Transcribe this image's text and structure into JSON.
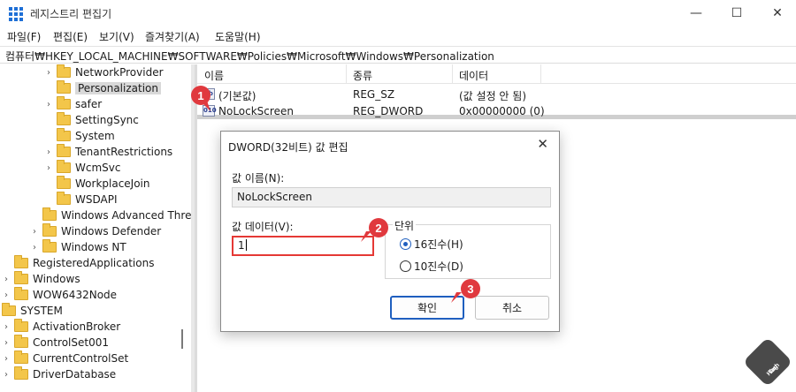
{
  "window": {
    "title": "레지스트리 편집기",
    "min_glyph": "—",
    "max_glyph": "☐",
    "close_glyph": "✕"
  },
  "menu": [
    "파일(F)",
    "편집(E)",
    "보기(V)",
    "즐겨찾기(A)",
    "도움말(H)"
  ],
  "address": "컴퓨터₩HKEY_LOCAL_MACHINE₩SOFTWARE₩Policies₩Microsoft₩Windows₩Personalization",
  "tree": [
    {
      "label": "NetworkProvider",
      "chevron": "›"
    },
    {
      "label": "Personalization",
      "chevron": "",
      "selected": true
    },
    {
      "label": "safer",
      "chevron": "›"
    },
    {
      "label": "SettingSync",
      "chevron": ""
    },
    {
      "label": "System",
      "chevron": ""
    },
    {
      "label": "TenantRestrictions",
      "chevron": "›"
    },
    {
      "label": "WcmSvc",
      "chevron": "›"
    },
    {
      "label": "WorkplaceJoin",
      "chevron": ""
    },
    {
      "label": "WSDAPI",
      "chevron": ""
    },
    {
      "label": "Windows Advanced Threat",
      "chevron": ""
    },
    {
      "label": "Windows Defender",
      "chevron": "›"
    },
    {
      "label": "Windows NT",
      "chevron": "›"
    },
    {
      "label": "RegisteredApplications",
      "chevron": ""
    },
    {
      "label": "Windows",
      "chevron": "›"
    },
    {
      "label": "WOW6432Node",
      "chevron": "›"
    },
    {
      "label": "SYSTEM",
      "chevron": ""
    },
    {
      "label": "ActivationBroker",
      "chevron": "›"
    },
    {
      "label": "ControlSet001",
      "chevron": "›"
    },
    {
      "label": "CurrentControlSet",
      "chevron": "›"
    },
    {
      "label": "DriverDatabase",
      "chevron": "›"
    }
  ],
  "list": {
    "columns": [
      "이름",
      "종류",
      "데이터"
    ],
    "rows": [
      {
        "name": "(기본값)",
        "type": "REG_SZ",
        "data": "(값 설정 안 됨)",
        "icon": "ab"
      },
      {
        "name": "NoLockScreen",
        "type": "REG_DWORD",
        "data": "0x00000000 (0)",
        "icon": "010"
      }
    ]
  },
  "dialog": {
    "title": "DWORD(32비트) 값 편집",
    "close_glyph": "✕",
    "name_label": "값 이름(N):",
    "name_value": "NoLockScreen",
    "data_label": "값 데이터(V):",
    "data_value": "1",
    "radix_label": "단위",
    "hex_label": "16진수(H)",
    "dec_label": "10진수(D)",
    "selected_radix": "hex",
    "ok_label": "확인",
    "cancel_label": "취소"
  },
  "badges": [
    "1",
    "2",
    "3"
  ],
  "badge_color": "#e0393e",
  "accent": "#1f5fbf",
  "watermark": {
    "line1": "Hash",
    "line2": "Tag"
  }
}
